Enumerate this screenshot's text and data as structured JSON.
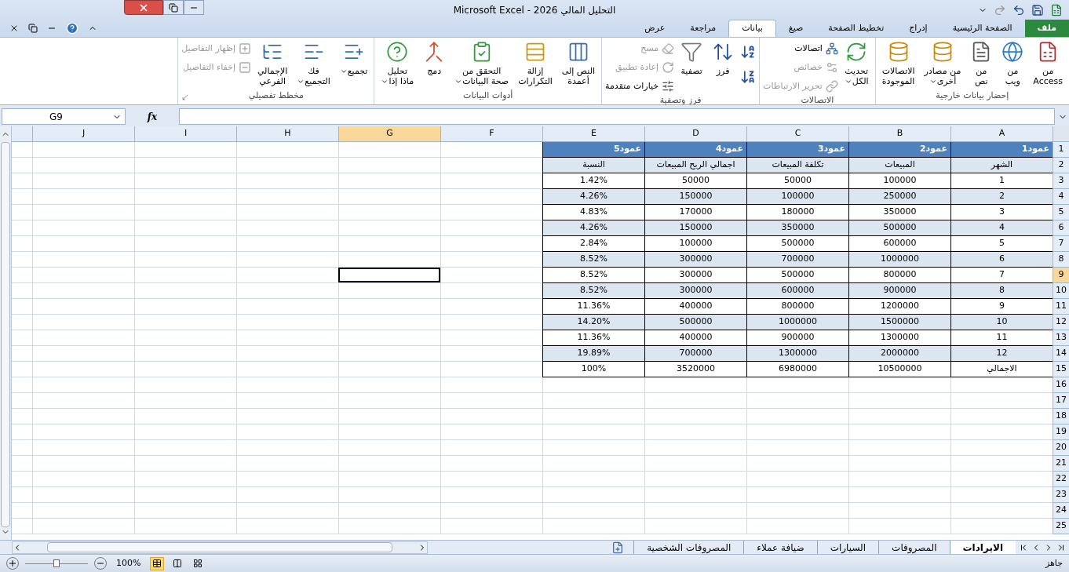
{
  "title_bar": {
    "title": "التحليل المالي 2026 - Microsoft Excel"
  },
  "ribbon_tabs": {
    "file_tab": "ملف",
    "tabs": [
      {
        "label": "الصفحة الرئيسية",
        "selected": false
      },
      {
        "label": "إدراج",
        "selected": false
      },
      {
        "label": "تخطيط الصفحة",
        "selected": false
      },
      {
        "label": "صيغ",
        "selected": false
      },
      {
        "label": "بيانات",
        "selected": true
      },
      {
        "label": "مراجعة",
        "selected": false
      },
      {
        "label": "عرض",
        "selected": false
      }
    ]
  },
  "ribbon_groups": [
    {
      "label": "إحضار بيانات خارجية",
      "items": [
        {
          "kind": "large",
          "label": "من\nAccess",
          "disabled": false,
          "dropdown": false
        },
        {
          "kind": "large",
          "label": "من\nويب",
          "disabled": false,
          "dropdown": false
        },
        {
          "kind": "large",
          "label": "من\nنص",
          "disabled": false,
          "dropdown": false
        },
        {
          "kind": "large",
          "label": "من مصادر\nأخرى",
          "disabled": false,
          "dropdown": true
        },
        {
          "kind": "large",
          "label": "الاتصالات\nالموجودة",
          "disabled": false,
          "dropdown": false
        }
      ]
    },
    {
      "label": "الاتصالات",
      "items": [
        {
          "kind": "large",
          "label": "تحديث\nالكل",
          "disabled": false,
          "dropdown": true
        },
        {
          "kind": "small",
          "label": "اتصالات",
          "disabled": false,
          "dropdown": false
        },
        {
          "kind": "small",
          "label": "خصائص",
          "disabled": true,
          "dropdown": false
        },
        {
          "kind": "small",
          "label": "تحرير الارتباطات",
          "disabled": true,
          "dropdown": false
        }
      ]
    },
    {
      "label": "فرز وتصفية",
      "items": [
        {
          "kind": "icon",
          "disabled": false,
          "dropdown": false
        },
        {
          "kind": "icon",
          "disabled": false,
          "dropdown": false
        },
        {
          "kind": "large",
          "label": "فرز",
          "disabled": false,
          "dropdown": false
        },
        {
          "kind": "large",
          "label": "تصفية",
          "disabled": false,
          "dropdown": false
        },
        {
          "kind": "small",
          "label": "مسح",
          "disabled": true,
          "dropdown": false
        },
        {
          "kind": "small",
          "label": "إعادة تطبيق",
          "disabled": true,
          "dropdown": false
        },
        {
          "kind": "small",
          "label": "خيارات متقدمة",
          "disabled": false,
          "dropdown": false
        }
      ]
    },
    {
      "label": "أدوات البيانات",
      "items": [
        {
          "kind": "large",
          "label": "النص إلى\nأعمدة",
          "disabled": false,
          "dropdown": false
        },
        {
          "kind": "large",
          "label": "إزالة\nالتكرارات",
          "disabled": false,
          "dropdown": false
        },
        {
          "kind": "large",
          "label": "التحقق من\nصحة البيانات",
          "disabled": false,
          "dropdown": true
        },
        {
          "kind": "large",
          "label": "دمج",
          "disabled": false,
          "dropdown": false
        },
        {
          "kind": "large",
          "label": "تحليل\nماذا إذا",
          "disabled": false,
          "dropdown": true
        }
      ]
    },
    {
      "label": "مخطط تفصيلي",
      "items": [
        {
          "kind": "large",
          "label": "تجميع",
          "disabled": false,
          "dropdown": true
        },
        {
          "kind": "large",
          "label": "فك\nالتجميع",
          "disabled": false,
          "dropdown": true
        },
        {
          "kind": "large",
          "label": "الإجمالي\nالفرعي",
          "disabled": false,
          "dropdown": false
        },
        {
          "kind": "small",
          "label": "إظهار التفاصيل",
          "disabled": true,
          "dropdown": false
        },
        {
          "kind": "small",
          "label": "إخفاء التفاصيل",
          "disabled": true,
          "dropdown": false
        }
      ]
    }
  ],
  "formula_bar": {
    "name_box": "G9",
    "function_label": "fx"
  },
  "sheet": {
    "columns": [
      {
        "label": "A",
        "selected": false
      },
      {
        "label": "B",
        "selected": false
      },
      {
        "label": "C",
        "selected": false
      },
      {
        "label": "D",
        "selected": false
      },
      {
        "label": "E",
        "selected": false
      },
      {
        "label": "F",
        "selected": false
      },
      {
        "label": "G",
        "selected": true
      },
      {
        "label": "H",
        "selected": false
      },
      {
        "label": "I",
        "selected": false
      },
      {
        "label": "J",
        "selected": false
      }
    ],
    "rows": [
      {
        "label": "1",
        "selected": false
      },
      {
        "label": "2",
        "selected": false
      },
      {
        "label": "3",
        "selected": false
      },
      {
        "label": "4",
        "selected": false
      },
      {
        "label": "5",
        "selected": false
      },
      {
        "label": "6",
        "selected": false
      },
      {
        "label": "7",
        "selected": false
      },
      {
        "label": "8",
        "selected": false
      },
      {
        "label": "9",
        "selected": true
      },
      {
        "label": "10",
        "selected": false
      },
      {
        "label": "11",
        "selected": false
      },
      {
        "label": "12",
        "selected": false
      },
      {
        "label": "13",
        "selected": false
      },
      {
        "label": "14",
        "selected": false
      },
      {
        "label": "15",
        "selected": false
      },
      {
        "label": "16",
        "selected": false
      },
      {
        "label": "17",
        "selected": false
      },
      {
        "label": "18",
        "selected": false
      },
      {
        "label": "19",
        "selected": false
      },
      {
        "label": "20",
        "selected": false
      },
      {
        "label": "21",
        "selected": false
      },
      {
        "label": "22",
        "selected": false
      },
      {
        "label": "23",
        "selected": false
      },
      {
        "label": "24",
        "selected": false
      },
      {
        "label": "25",
        "selected": false
      }
    ],
    "table": [
      {
        "kind": "title",
        "cells": [
          "عمود1",
          "عمود2",
          "عمود3",
          "عمود4",
          "عمود5"
        ]
      },
      {
        "kind": "subheader",
        "shaded": true,
        "cells": [
          "الشهر",
          "المبيعات",
          "تكلفة المبيعات",
          "اجمالي الربح المبيعات",
          "النسبة"
        ]
      },
      {
        "kind": "data",
        "shaded": false,
        "cells": [
          "1",
          "100000",
          "50000",
          "50000",
          "1.42%"
        ]
      },
      {
        "kind": "data",
        "shaded": true,
        "cells": [
          "2",
          "250000",
          "100000",
          "150000",
          "4.26%"
        ]
      },
      {
        "kind": "data",
        "shaded": false,
        "cells": [
          "3",
          "350000",
          "180000",
          "170000",
          "4.83%"
        ]
      },
      {
        "kind": "data",
        "shaded": true,
        "cells": [
          "4",
          "500000",
          "350000",
          "150000",
          "4.26%"
        ]
      },
      {
        "kind": "data",
        "shaded": false,
        "cells": [
          "5",
          "600000",
          "500000",
          "100000",
          "2.84%"
        ]
      },
      {
        "kind": "data",
        "shaded": true,
        "cells": [
          "6",
          "1000000",
          "700000",
          "300000",
          "8.52%"
        ]
      },
      {
        "kind": "data",
        "shaded": false,
        "cells": [
          "7",
          "800000",
          "500000",
          "300000",
          "8.52%"
        ]
      },
      {
        "kind": "data",
        "shaded": true,
        "cells": [
          "8",
          "900000",
          "600000",
          "300000",
          "8.52%"
        ]
      },
      {
        "kind": "data",
        "shaded": false,
        "cells": [
          "9",
          "1200000",
          "800000",
          "400000",
          "11.36%"
        ]
      },
      {
        "kind": "data",
        "shaded": true,
        "cells": [
          "10",
          "1500000",
          "1000000",
          "500000",
          "14.20%"
        ]
      },
      {
        "kind": "data",
        "shaded": false,
        "cells": [
          "11",
          "1300000",
          "900000",
          "400000",
          "11.36%"
        ]
      },
      {
        "kind": "data",
        "shaded": true,
        "cells": [
          "12",
          "2000000",
          "1300000",
          "700000",
          "19.89%"
        ]
      },
      {
        "kind": "data",
        "shaded": false,
        "cells": [
          "الاجمالي",
          "10500000",
          "6980000",
          "3520000",
          "100%"
        ]
      }
    ]
  },
  "sheet_tabs": [
    {
      "label": "الايرادات",
      "selected": true
    },
    {
      "label": "المصروفات",
      "selected": false
    },
    {
      "label": "السيارات",
      "selected": false
    },
    {
      "label": "ضيافة عملاء",
      "selected": false
    },
    {
      "label": "المصروفات الشخصية",
      "selected": false
    }
  ],
  "status_bar": {
    "status": "جاهز",
    "zoom": {
      "label": "100%",
      "level": 0.5
    },
    "view_modes": [
      {
        "selected": true
      },
      {
        "selected": false
      },
      {
        "selected": false
      }
    ]
  }
}
